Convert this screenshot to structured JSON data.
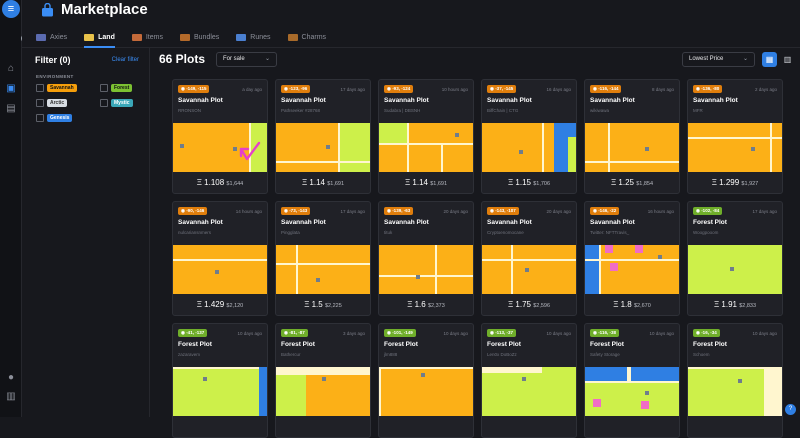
{
  "app": {
    "title": "Marketplace"
  },
  "tabs": [
    {
      "label": "Axies",
      "color": "#5b6bb0"
    },
    {
      "label": "Land",
      "color": "#e8c24a"
    },
    {
      "label": "Items",
      "color": "#c46a3a"
    },
    {
      "label": "Bundles",
      "color": "#b46a2a"
    },
    {
      "label": "Runes",
      "color": "#4a7fd0"
    },
    {
      "label": "Charms",
      "color": "#a86a2a"
    }
  ],
  "filter": {
    "title": "Filter (0)",
    "clear_label": "Clear filter",
    "section": "ENVIRONMENT",
    "options": [
      {
        "label": "Savannah",
        "color": "#f59e0b"
      },
      {
        "label": "Forest",
        "color": "#7cc132"
      },
      {
        "label": "Arctic",
        "color": "#d8dde3"
      },
      {
        "label": "Mystic",
        "color": "#3aa7b8"
      },
      {
        "label": "Genesis",
        "color": "#2f7fe3"
      }
    ]
  },
  "toolbar": {
    "count": "66 Plots",
    "sale_filter": "For sale",
    "sort": "Lowest Price"
  },
  "colors": {
    "savannah": "#fcb017",
    "forest": "#cdf04a",
    "road": "#fff6cf",
    "water": "#2f7fe3",
    "accent": "#3a8df5"
  },
  "cards": [
    {
      "coord": "-149, -115",
      "time": "a day ago",
      "name": "Savannah Plot",
      "owner": "RRONSON",
      "eth": "Ξ 1.108",
      "usd": "$1,644",
      "type": "savannah"
    },
    {
      "coord": "-123, -96",
      "time": "17 days ago",
      "name": "Savannah Plot",
      "owner": "Pathseeker #28768",
      "eth": "Ξ 1.14",
      "usd": "$1,691",
      "type": "savannah"
    },
    {
      "coord": "-93, -124",
      "time": "10 hours ago",
      "name": "Savannah Plot",
      "owner": "Sudabra | DBSNH",
      "eth": "Ξ 1.14",
      "usd": "$1,691",
      "type": "savannah"
    },
    {
      "coord": "-37, -145",
      "time": "16 days ago",
      "name": "Savannah Plot",
      "owner": "BiffChain | CTG",
      "eth": "Ξ 1.15",
      "usd": "$1,706",
      "type": "savannah"
    },
    {
      "coord": "-116, -144",
      "time": "8 days ago",
      "name": "Savannah Plot",
      "owner": "wikiwawa",
      "eth": "Ξ 1.25",
      "usd": "$1,854",
      "type": "savannah"
    },
    {
      "coord": "-136, -80",
      "time": "2 days ago",
      "name": "Savannah Plot",
      "owner": "MFR",
      "eth": "Ξ 1.299",
      "usd": "$1,927",
      "type": "savannah"
    },
    {
      "coord": "-90, -146",
      "time": "14 hours ago",
      "name": "Savannah Plot",
      "owner": "nulcariansnmers",
      "eth": "Ξ 1.429",
      "usd": "$2,120",
      "type": "savannah"
    },
    {
      "coord": "-73, -143",
      "time": "17 days ago",
      "name": "Savannah Plot",
      "owner": "Pingglata",
      "eth": "Ξ 1.5",
      "usd": "$2,225",
      "type": "savannah"
    },
    {
      "coord": "-139, -63",
      "time": "20 days ago",
      "name": "Savannah Plot",
      "owner": "tituk",
      "eth": "Ξ 1.6",
      "usd": "$2,373",
      "type": "savannah"
    },
    {
      "coord": "-143, -107",
      "time": "20 days ago",
      "name": "Savannah Plot",
      "owner": "Cryptoenomocane",
      "eth": "Ξ 1.75",
      "usd": "$2,596",
      "type": "savannah"
    },
    {
      "coord": "-146, -22",
      "time": "16 hours ago",
      "name": "Savannah Plot",
      "owner": "Twitter: NFTTravis_",
      "eth": "Ξ 1.8",
      "usd": "$2,670",
      "type": "savannah"
    },
    {
      "coord": "-102, -84",
      "time": "17 days ago",
      "name": "Forest Plot",
      "owner": "Woogpooom",
      "eth": "Ξ 1.91",
      "usd": "$2,833",
      "type": "forest"
    },
    {
      "coord": "-41, -137",
      "time": "10 days ago",
      "name": "Forest Plot",
      "owner": "zazaravem",
      "eth": "",
      "usd": "",
      "type": "forest"
    },
    {
      "coord": "-81, -87",
      "time": "3 days ago",
      "name": "Forest Plot",
      "owner": "Bathercur",
      "eth": "",
      "usd": "",
      "type": "forest"
    },
    {
      "coord": "-101, -149",
      "time": "10 days ago",
      "name": "Forest Plot",
      "owner": "jlm888",
      "eth": "",
      "usd": "",
      "type": "forest"
    },
    {
      "coord": "-113, -37",
      "time": "10 days ago",
      "name": "Forest Plot",
      "owner": "Len0x DoBoZz",
      "eth": "",
      "usd": "",
      "type": "forest"
    },
    {
      "coord": "-116, -38",
      "time": "10 days ago",
      "name": "Forest Plot",
      "owner": "Safety Storage",
      "eth": "",
      "usd": "",
      "type": "forest"
    },
    {
      "coord": "-16, -34",
      "time": "10 days ago",
      "name": "Forest Plot",
      "owner": "Schoem",
      "eth": "",
      "usd": "",
      "type": "forest"
    }
  ]
}
